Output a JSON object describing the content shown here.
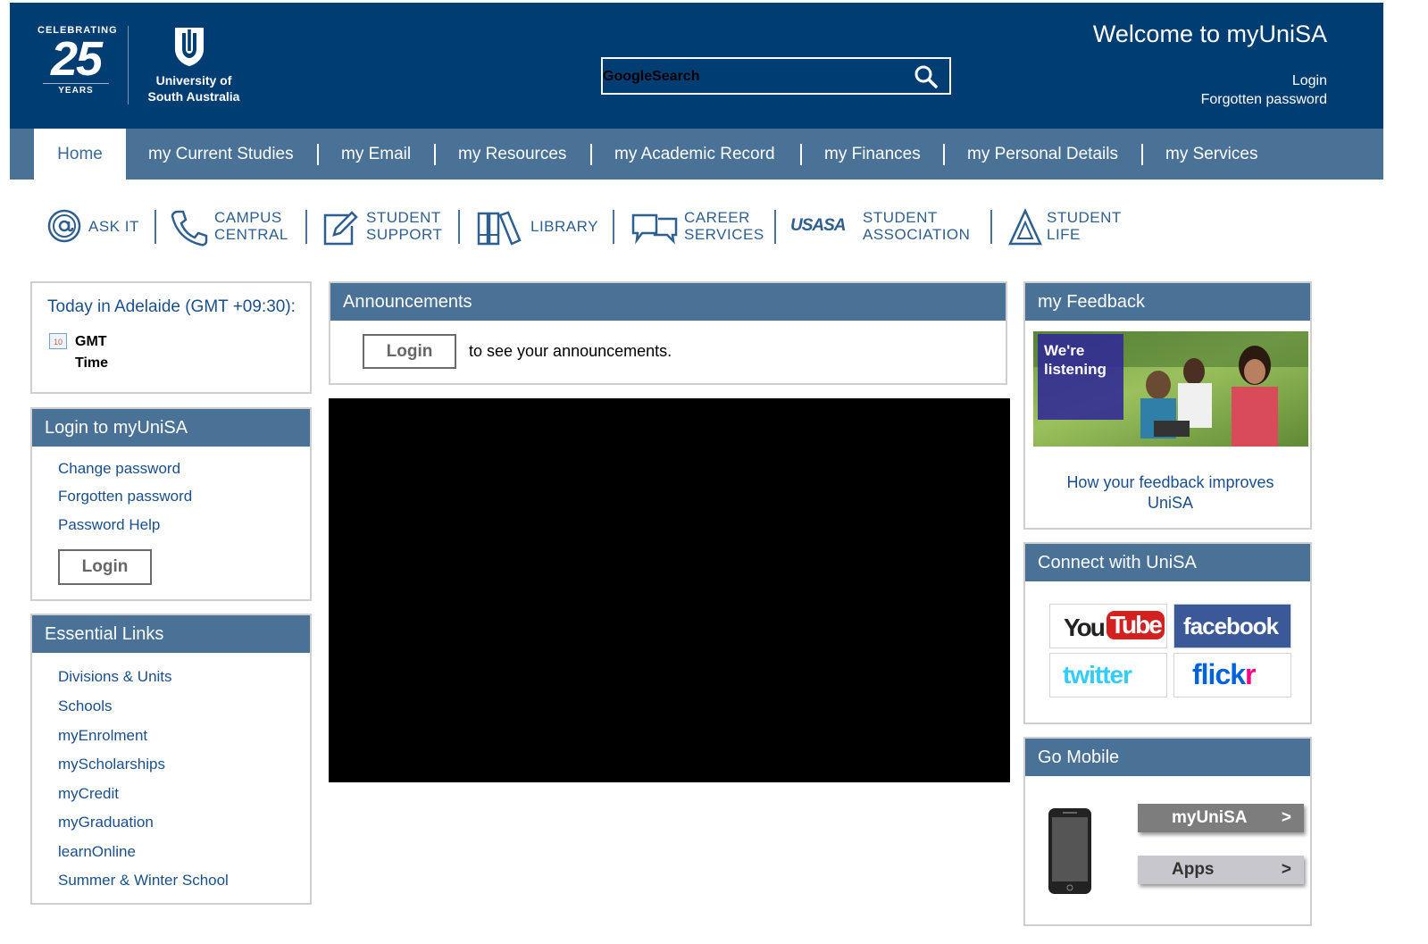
{
  "header": {
    "logo25": {
      "top": "CELEBRATING",
      "number": "25",
      "bottom": "YEARS"
    },
    "university_name_line1": "University of",
    "university_name_line2": "South Australia",
    "search_placeholder": "GoogleSearch",
    "welcome": "Welcome to myUniSA",
    "login_link": "Login",
    "forgotten_link": "Forgotten password",
    "brand_color": "#003d72"
  },
  "nav": {
    "items": [
      {
        "label": "Home",
        "active": true
      },
      {
        "label": "my Current Studies"
      },
      {
        "label": "my Email"
      },
      {
        "label": "my Resources"
      },
      {
        "label": "my Academic Record"
      },
      {
        "label": "my Finances"
      },
      {
        "label": "my Personal Details"
      },
      {
        "label": "my Services"
      }
    ]
  },
  "services": [
    {
      "icon": "at-icon",
      "line1": "ASK IT",
      "line2": ""
    },
    {
      "icon": "phone-icon",
      "line1": "CAMPUS",
      "line2": "CENTRAL"
    },
    {
      "icon": "pencil-icon",
      "line1": "STUDENT",
      "line2": "SUPPORT"
    },
    {
      "icon": "books-icon",
      "line1": "LIBRARY",
      "line2": ""
    },
    {
      "icon": "speech-bubbles-icon",
      "line1": "CAREER",
      "line2": "SERVICES"
    },
    {
      "icon": "usasa-logo-icon",
      "logo_text": "USASA",
      "line1": "STUDENT",
      "line2": "ASSOCIATION"
    },
    {
      "icon": "triangle-icon",
      "line1": "STUDENT",
      "line2": "LIFE"
    }
  ],
  "today": {
    "title": "Today in Adelaide (GMT +09:30):",
    "calendar_day": "10",
    "line1": "GMT",
    "line2": "Time"
  },
  "login_panel": {
    "title": "Login to myUniSA",
    "links": [
      "Change password",
      "Forgotten password",
      "Password Help"
    ],
    "button": "Login"
  },
  "essential": {
    "title": "Essential Links",
    "links": [
      "Divisions & Units",
      "Schools",
      "myEnrolment",
      "myScholarships",
      "myCredit",
      "myGraduation",
      "learnOnline",
      "Summer & Winter School"
    ]
  },
  "announcements": {
    "title": "Announcements",
    "button": "Login",
    "text": "to see your announcements."
  },
  "feedback": {
    "title": "my Feedback",
    "banner_line1": "We're",
    "banner_line2": "listening",
    "link": "How your feedback improves UniSA"
  },
  "connect": {
    "title": "Connect with UniSA",
    "youtube_you": "You",
    "youtube_tube": "Tube",
    "facebook": "facebook",
    "twitter": "twitter",
    "flickr_fl": "flick",
    "flickr_r": "r"
  },
  "mobile": {
    "title": "Go Mobile",
    "btn1": "myUniSA",
    "btn2": "Apps",
    "arrow": ">"
  }
}
